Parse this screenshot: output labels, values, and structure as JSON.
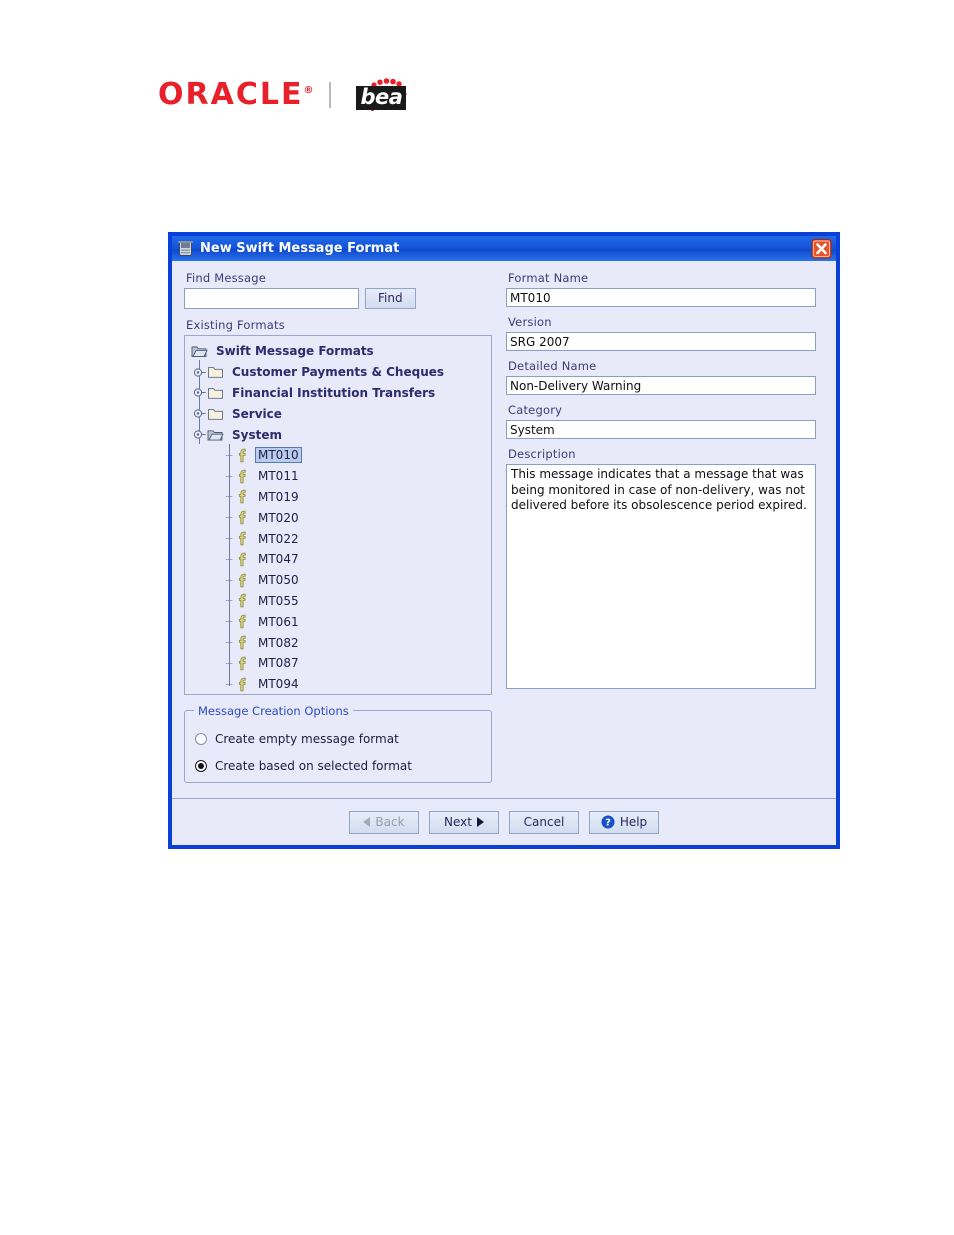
{
  "brand": {
    "oracle": "ORACLE",
    "oracle_mark": "®",
    "separator": "|",
    "bea": "bea"
  },
  "dialog": {
    "title": "New Swift Message Format",
    "title_icon": "app-window-icon",
    "close_icon": "close-icon",
    "accent_color": "#0840d8",
    "titlebar_color": "#1556d8",
    "background_color": "#e9eaf9"
  },
  "left": {
    "find_label": "Find Message",
    "find_value": "",
    "find_placeholder": "",
    "find_button": "Find",
    "existing_label": "Existing Formats",
    "tree": {
      "root": {
        "label": "Swift Message Formats",
        "icon": "open-folder-icon",
        "expanded": true
      },
      "branches": [
        {
          "label": "Customer Payments & Cheques",
          "icon": "folder-icon",
          "expanded": false
        },
        {
          "label": "Financial Institution Transfers",
          "icon": "folder-icon",
          "expanded": false
        },
        {
          "label": "Service",
          "icon": "folder-icon",
          "expanded": false
        },
        {
          "label": "System",
          "icon": "open-folder-icon",
          "expanded": true
        }
      ],
      "leaves": [
        {
          "label": "MT010",
          "icon": "format-icon",
          "selected": true
        },
        {
          "label": "MT011",
          "icon": "format-icon",
          "selected": false
        },
        {
          "label": "MT019",
          "icon": "format-icon",
          "selected": false
        },
        {
          "label": "MT020",
          "icon": "format-icon",
          "selected": false
        },
        {
          "label": "MT022",
          "icon": "format-icon",
          "selected": false
        },
        {
          "label": "MT047",
          "icon": "format-icon",
          "selected": false
        },
        {
          "label": "MT050",
          "icon": "format-icon",
          "selected": false
        },
        {
          "label": "MT055",
          "icon": "format-icon",
          "selected": false
        },
        {
          "label": "MT061",
          "icon": "format-icon",
          "selected": false
        },
        {
          "label": "MT082",
          "icon": "format-icon",
          "selected": false
        },
        {
          "label": "MT087",
          "icon": "format-icon",
          "selected": false
        },
        {
          "label": "MT094",
          "icon": "format-icon",
          "selected": false
        }
      ]
    }
  },
  "right": {
    "format_name_label": "Format Name",
    "format_name_value": "MT010",
    "version_label": "Version",
    "version_value": "SRG 2007",
    "detailed_name_label": "Detailed Name",
    "detailed_name_value": "Non-Delivery Warning",
    "category_label": "Category",
    "category_value": "System",
    "description_label": "Description",
    "description_value": "This message indicates that a message that was being monitored in case of non-delivery, was not delivered before its obsolescence period expired."
  },
  "options": {
    "group_title": "Message Creation Options",
    "items": [
      {
        "label": "Create empty message format",
        "selected": false
      },
      {
        "label": "Create based on selected format",
        "selected": true
      }
    ]
  },
  "buttons": {
    "back": "Back",
    "back_disabled": true,
    "next": "Next",
    "cancel": "Cancel",
    "help": "Help",
    "help_icon": "question-circle-icon"
  }
}
